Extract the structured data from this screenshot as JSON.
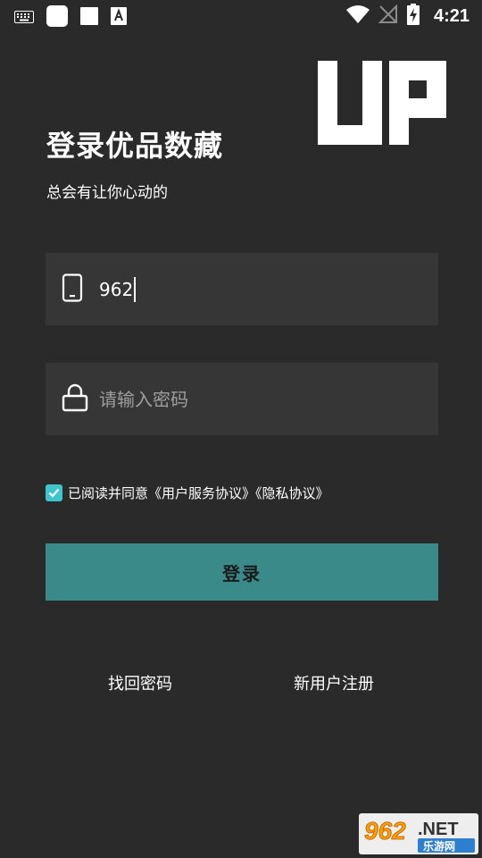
{
  "status_bar": {
    "time": "4:21",
    "left_icons": [
      "keyboard-icon",
      "app-icon",
      "square-icon",
      "font-icon"
    ],
    "right_icons": [
      "wifi-icon",
      "no-signal-icon",
      "battery-charging-icon"
    ]
  },
  "header": {
    "logo_text": "UP",
    "title": "登录优品数藏",
    "subtitle": "总会有让你心动的"
  },
  "phone_field": {
    "icon": "phone-icon",
    "value": "962"
  },
  "password_field": {
    "icon": "lock-icon",
    "placeholder": "请输入密码",
    "value": ""
  },
  "agreement": {
    "checked": true,
    "text": "已阅读并同意《用户服务协议》《隐私协议》"
  },
  "login_button": {
    "label": "登录"
  },
  "links": {
    "forgot_password": "找回密码",
    "register": "新用户注册"
  },
  "watermark": {
    "number": "962",
    "suffix": ".NET",
    "name": "乐游网"
  },
  "colors": {
    "background": "#2a2a2a",
    "field": "#363636",
    "accent": "#3a8a8a",
    "checkbox": "#3ec6cf"
  }
}
